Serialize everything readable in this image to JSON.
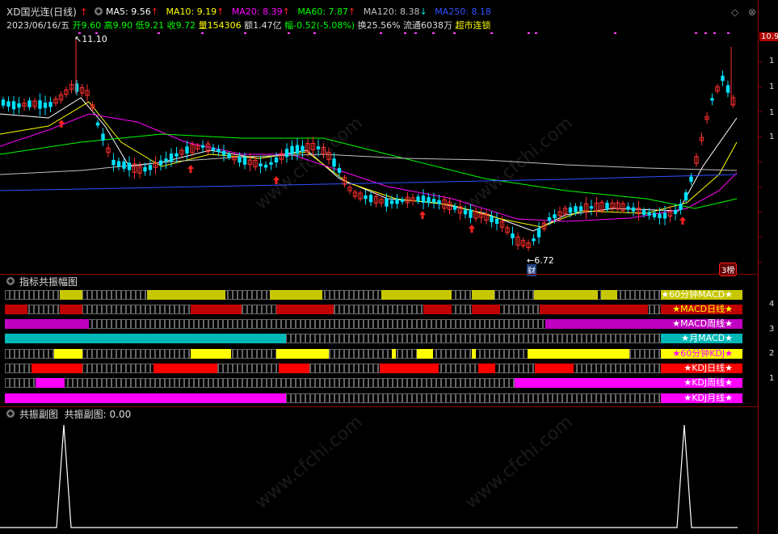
{
  "header": {
    "stock_name": "XD国光连(日线)",
    "arrow_up": "↑",
    "ma5": "MA5: 9.56",
    "ma10": "MA10: 9.19",
    "ma20": "MA20: 8.39",
    "ma60": "MA60: 7.87",
    "ma120": "MA120: 8.38",
    "ma250": "MA250: 8.18",
    "ma5_color": "#ffffff",
    "ma10_color": "#ffff00",
    "ma20_color": "#ff00ff",
    "ma60_color": "#00ff00",
    "ma120_color": "#c0c0c0",
    "ma250_color": "#3050ff",
    "info_date": "2023/06/16/五",
    "info_open": "开9.60",
    "info_high": "高9.90",
    "info_low": "低9.21",
    "info_close": "收9.72",
    "info_vol": "量154306",
    "info_amount": "额1.47亿",
    "info_change": "幅-0.52(-5.08%)",
    "info_turnover": "换25.56%",
    "info_float": "流通6038万",
    "info_tag": "超市连锁"
  },
  "main_chart": {
    "high_label": "11.10",
    "low_label": "6.72",
    "cai_label": "财",
    "badge_label": "3榜",
    "price_tag": "10.9",
    "right_axis": [
      "1",
      "1",
      "1",
      "1",
      "",
      "",
      "",
      "",
      "",
      "",
      ""
    ]
  },
  "band_panel": {
    "title": "指标共振幅图",
    "right_axis": [
      "4",
      "3",
      "2",
      "1"
    ],
    "rows": [
      {
        "label": "★60分钟MACD★",
        "label_color": "#ffffff",
        "bar_color": "#c8c800"
      },
      {
        "label": "★MACD日线★",
        "label_color": "#ffff00",
        "bar_color": "#c00000"
      },
      {
        "label": "★MACD周线★",
        "label_color": "#ffffff",
        "bar_color": "#c000c0"
      },
      {
        "label": "★月MACD★",
        "label_color": "#ffffff",
        "bar_color": "#00b8b8"
      },
      {
        "label": "★60分钟KDJ★",
        "label_color": "#ff00ff",
        "bar_color": "#ffff00"
      },
      {
        "label": "★KDJ日线★",
        "label_color": "#ffffff",
        "bar_color": "#ff0000"
      },
      {
        "label": "★KDJ周线★",
        "label_color": "#ffffff",
        "bar_color": "#ff00ff"
      },
      {
        "label": "★KDJ月线★",
        "label_color": "#ffffff",
        "bar_color": "#ff00ff"
      }
    ]
  },
  "sub_panel": {
    "title": "共振副图",
    "value_label": "共振副图: 0.00"
  },
  "watermark": "www.cfchi.com"
}
